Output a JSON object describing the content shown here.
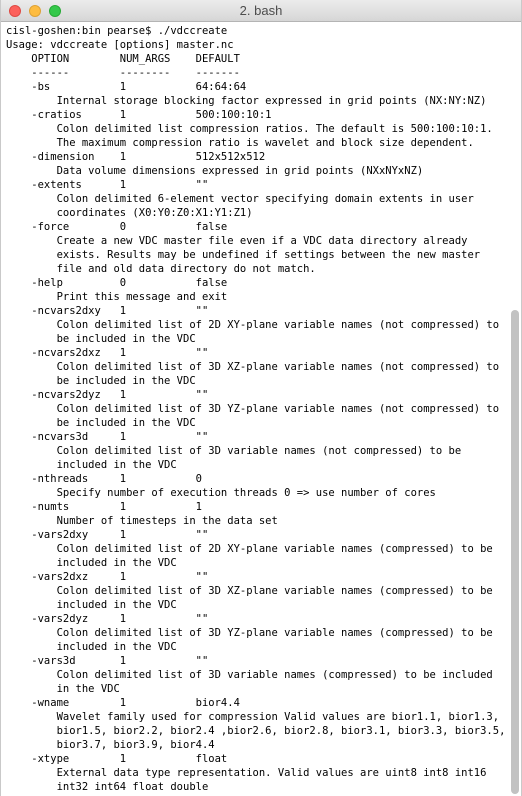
{
  "window": {
    "title": "2. bash"
  },
  "terminal": {
    "lines": [
      "cisl-goshen:bin pearse$ ./vdccreate",
      "Usage: vdccreate [options] master.nc",
      "    OPTION        NUM_ARGS    DEFAULT",
      "    ------        --------    -------",
      "    -bs           1           64:64:64",
      "        Internal storage blocking factor expressed in grid points (NX:NY:NZ)",
      "    -cratios      1           500:100:10:1",
      "        Colon delimited list compression ratios. The default is 500:100:10:1.",
      "        The maximum compression ratio is wavelet and block size dependent.",
      "    -dimension    1           512x512x512",
      "        Data volume dimensions expressed in grid points (NXxNYxNZ)",
      "    -extents      1           \"\"",
      "        Colon delimited 6-element vector specifying domain extents in user",
      "        coordinates (X0:Y0:Z0:X1:Y1:Z1)",
      "    -force        0           false",
      "        Create a new VDC master file even if a VDC data directory already",
      "        exists. Results may be undefined if settings between the new master",
      "        file and old data directory do not match.",
      "    -help         0           false",
      "        Print this message and exit",
      "    -ncvars2dxy   1           \"\"",
      "        Colon delimited list of 2D XY-plane variable names (not compressed) to",
      "        be included in the VDC",
      "    -ncvars2dxz   1           \"\"",
      "        Colon delimited list of 3D XZ-plane variable names (not compressed) to",
      "        be included in the VDC",
      "    -ncvars2dyz   1           \"\"",
      "        Colon delimited list of 3D YZ-plane variable names (not compressed) to",
      "        be included in the VDC",
      "    -ncvars3d     1           \"\"",
      "        Colon delimited list of 3D variable names (not compressed) to be",
      "        included in the VDC",
      "    -nthreads     1           0",
      "        Specify number of execution threads 0 => use number of cores",
      "    -numts        1           1",
      "        Number of timesteps in the data set",
      "    -vars2dxy     1           \"\"",
      "        Colon delimited list of 2D XY-plane variable names (compressed) to be",
      "        included in the VDC",
      "    -vars2dxz     1           \"\"",
      "        Colon delimited list of 3D XZ-plane variable names (compressed) to be",
      "        included in the VDC",
      "    -vars2dyz     1           \"\"",
      "        Colon delimited list of 3D YZ-plane variable names (compressed) to be",
      "        included in the VDC",
      "    -vars3d       1           \"\"",
      "        Colon delimited list of 3D variable names (compressed) to be included",
      "        in the VDC",
      "    -wname        1           bior4.4",
      "        Wavelet family used for compression Valid values are bior1.1, bior1.3,",
      "        bior1.5, bior2.2, bior2.4 ,bior2.6, bior2.8, bior3.1, bior3.3, bior3.5,",
      "        bior3.7, bior3.9, bior4.4",
      "    -xtype        1           float",
      "        External data type representation. Valid values are uint8 int8 int16",
      "        int32 int64 float double"
    ]
  }
}
